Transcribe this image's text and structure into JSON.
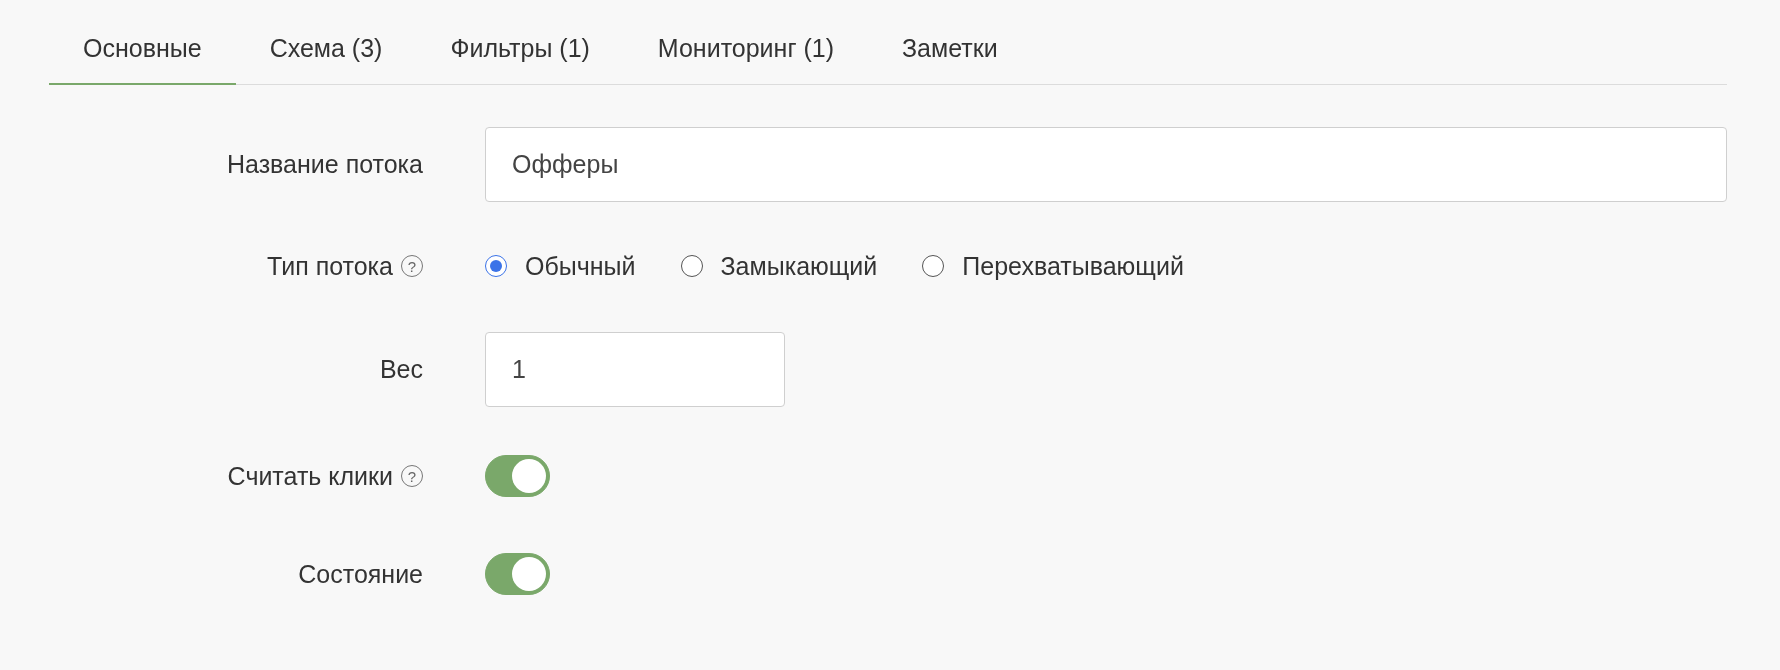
{
  "tabs": [
    {
      "label": "Основные",
      "selected": true
    },
    {
      "label": "Схема (3)",
      "selected": false
    },
    {
      "label": "Фильтры (1)",
      "selected": false
    },
    {
      "label": "Мониторинг (1)",
      "selected": false
    },
    {
      "label": "Заметки",
      "selected": false
    }
  ],
  "form": {
    "name": {
      "label": "Название потока",
      "value": "Офферы"
    },
    "type": {
      "label": "Тип потока",
      "help": "?",
      "options": [
        {
          "label": "Обычный",
          "selected": true
        },
        {
          "label": "Замыкающий",
          "selected": false
        },
        {
          "label": "Перехватывающий",
          "selected": false
        }
      ]
    },
    "weight": {
      "label": "Вес",
      "value": "1"
    },
    "count_clicks": {
      "label": "Считать клики",
      "help": "?",
      "on": true
    },
    "state": {
      "label": "Состояние",
      "on": true
    }
  }
}
